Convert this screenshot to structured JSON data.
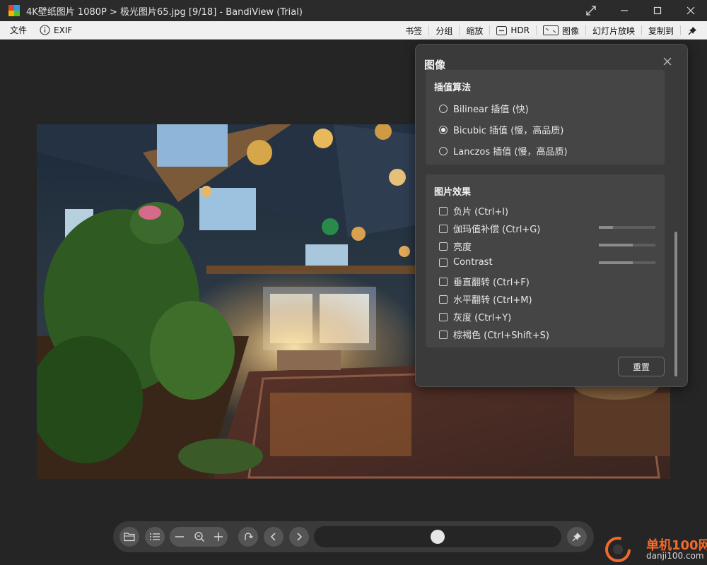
{
  "titlebar": {
    "title": "4K壁纸图片 1080P > 极光图片65.jpg [9/18] - BandiView (Trial)",
    "logo_colors": [
      "#e8412c",
      "#2f9be8",
      "#f5b400",
      "#5cbf2a"
    ]
  },
  "menubar": {
    "file": "文件",
    "exif": "EXIF",
    "bookmark": "书签",
    "group": "分组",
    "zoom": "缩放",
    "hdr": "HDR",
    "image": "图像",
    "slideshow": "幻灯片放映",
    "copy_to": "复制到"
  },
  "panel": {
    "title": "图像",
    "interpolation": {
      "title": "插值算法",
      "options": [
        {
          "label": "Bilinear 插值 (快)",
          "selected": false
        },
        {
          "label": "Bicubic 插值 (慢，高品质)",
          "selected": true
        },
        {
          "label": "Lanczos 插值 (慢，高品质)",
          "selected": false
        }
      ]
    },
    "effects": {
      "title": "图片效果",
      "items": [
        {
          "label": "负片 (Ctrl+I)",
          "checked": false
        },
        {
          "label": "伽玛值补偿 (Ctrl+G)",
          "checked": false,
          "level": 0.25
        },
        {
          "label": "亮度",
          "checked": false,
          "level": 0.6
        },
        {
          "label": "Contrast",
          "checked": false,
          "level": 0.6
        },
        {
          "label": "垂直翻转 (Ctrl+F)",
          "checked": false
        },
        {
          "label": "水平翻转 (Ctrl+M)",
          "checked": false
        },
        {
          "label": "灰度  (Ctrl+Y)",
          "checked": false
        },
        {
          "label": "棕褐色 (Ctrl+Shift+S)",
          "checked": false
        }
      ]
    },
    "reset": "重置"
  },
  "bottombar": {
    "seek_position": 0.5
  },
  "watermark": {
    "brand": "单机100网",
    "domain": "danji100.com",
    "color": "#f06a2b"
  }
}
